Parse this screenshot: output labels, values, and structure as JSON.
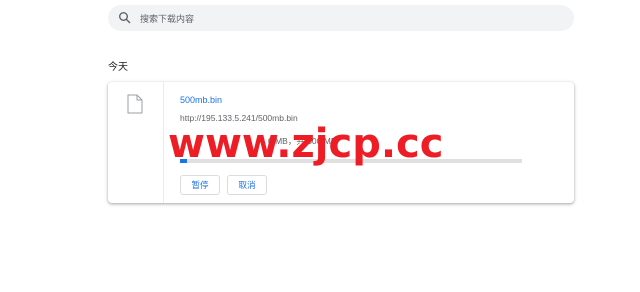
{
  "search": {
    "placeholder": "搜索下载内容",
    "icon": "search-icon"
  },
  "section": {
    "date_label": "今天"
  },
  "download": {
    "file_icon": "file-icon",
    "filename": "500mb.bin",
    "url": "http://195.133.5.241/500mb.bin",
    "status": "0 MB，共 500 MB",
    "progress": 0.02,
    "pause_label": "暂停",
    "cancel_label": "取消"
  },
  "watermark": {
    "text": "www.zjcp.cc"
  },
  "colors": {
    "accent": "#1a73e8",
    "watermark": "#ee1c25",
    "search_bg": "#f1f3f4"
  }
}
